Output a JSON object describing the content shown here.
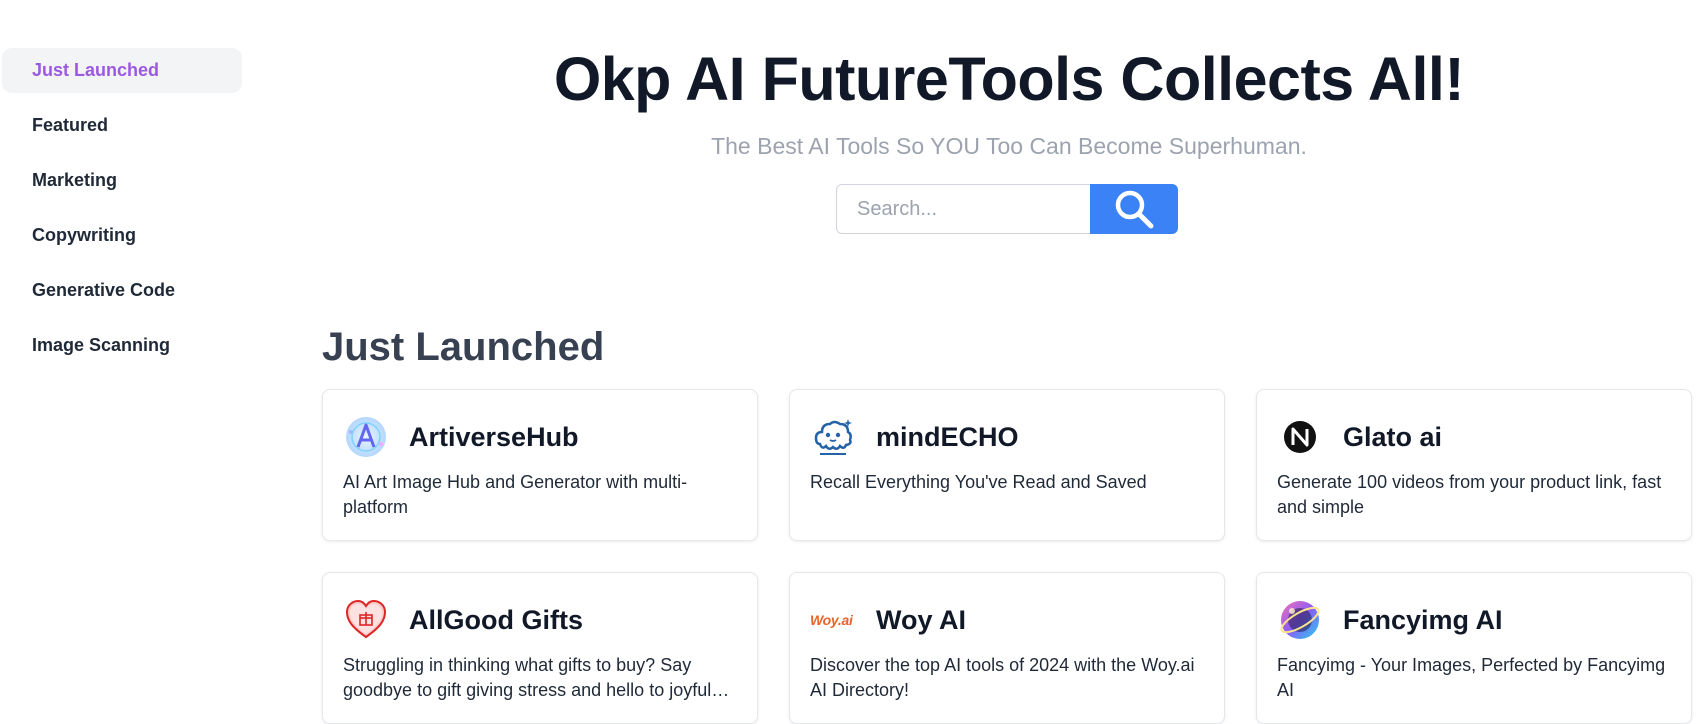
{
  "sidebar": {
    "items": [
      {
        "label": "Just Launched",
        "active": true
      },
      {
        "label": "Featured",
        "active": false
      },
      {
        "label": "Marketing",
        "active": false
      },
      {
        "label": "Copywriting",
        "active": false
      },
      {
        "label": "Generative Code",
        "active": false
      },
      {
        "label": "Image Scanning",
        "active": false
      }
    ]
  },
  "hero": {
    "title": "Okp AI FutureTools Collects All!",
    "subtitle": "The Best AI Tools So YOU Too Can Become Superhuman."
  },
  "search": {
    "placeholder": "Search...",
    "value": "",
    "button_icon": "search-icon"
  },
  "section": {
    "title": "Just Launched"
  },
  "cards": [
    {
      "name": "ArtiverseHub",
      "description": "AI Art Image Hub and Generator with multi-platform",
      "icon": "artiversehub-logo"
    },
    {
      "name": "mindECHO",
      "description": "Recall Everything You've Read and Saved",
      "icon": "mindecho-logo"
    },
    {
      "name": "Glato ai",
      "description": "Generate 100 videos from your product link, fast and simple",
      "icon": "glato-logo"
    },
    {
      "name": "AllGood Gifts",
      "description": "Struggling in thinking what gifts to buy? Say goodbye to gift giving stress and hello to joyful gifting",
      "icon": "allgood-gifts-logo"
    },
    {
      "name": "Woy AI",
      "description": "Discover the top AI tools of 2024 with the Woy.ai AI Directory!",
      "icon": "woy-ai-logo",
      "logo_text": "Woy.ai"
    },
    {
      "name": "Fancyimg AI",
      "description": "Fancyimg - Your Images, Perfected by Fancyimg AI",
      "icon": "fancyimg-logo"
    }
  ],
  "colors": {
    "accent": "#3b82f6",
    "active_nav": "#9b59e0",
    "title": "#111827",
    "subtitle": "#9ca3af"
  }
}
